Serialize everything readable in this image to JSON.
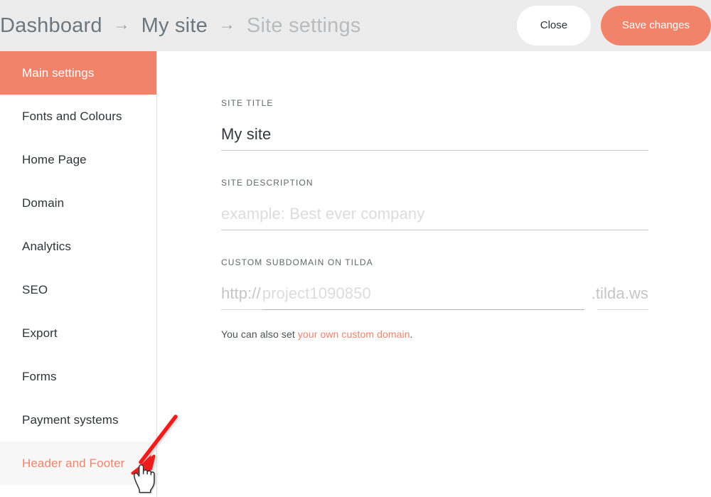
{
  "theme": {
    "accent": "#f2836b",
    "header_bg": "#ececec",
    "sidebar_hover_bg": "#f7f7f7",
    "text_dark": "#2f3438",
    "text_muted": "#b9bcbe",
    "annotation_arrow": "#ee1c1c"
  },
  "header": {
    "breadcrumb": [
      {
        "label": "Dashboard",
        "current": false
      },
      {
        "label": "My site",
        "current": false
      },
      {
        "label": "Site settings",
        "current": true
      }
    ],
    "separator": "→",
    "close_label": "Close",
    "save_label": "Save changes"
  },
  "sidebar": {
    "items": [
      {
        "label": "Main settings",
        "state": "active"
      },
      {
        "label": "Fonts and Colours",
        "state": "normal"
      },
      {
        "label": "Home Page",
        "state": "normal"
      },
      {
        "label": "Domain",
        "state": "normal"
      },
      {
        "label": "Analytics",
        "state": "normal"
      },
      {
        "label": "SEO",
        "state": "normal"
      },
      {
        "label": "Export",
        "state": "normal"
      },
      {
        "label": "Forms",
        "state": "normal"
      },
      {
        "label": "Payment systems",
        "state": "normal"
      },
      {
        "label": "Header and Footer",
        "state": "hovered"
      }
    ]
  },
  "main": {
    "site_title": {
      "label": "SITE TITLE",
      "value": "My site",
      "placeholder": ""
    },
    "site_description": {
      "label": "SITE DESCRIPTION",
      "value": "",
      "placeholder": "example: Best ever company"
    },
    "custom_subdomain": {
      "label": "CUSTOM SUBDOMAIN ON TILDA",
      "prefix": "http://",
      "value": "",
      "placeholder": "project1090850",
      "suffix": ".tilda.ws"
    },
    "helper": {
      "text_before": "You can also set ",
      "link_text": "your own custom domain",
      "text_after": "."
    }
  },
  "annotation": {
    "arrow_name": "red-pointer-arrow",
    "cursor_name": "pointing-hand-cursor"
  }
}
